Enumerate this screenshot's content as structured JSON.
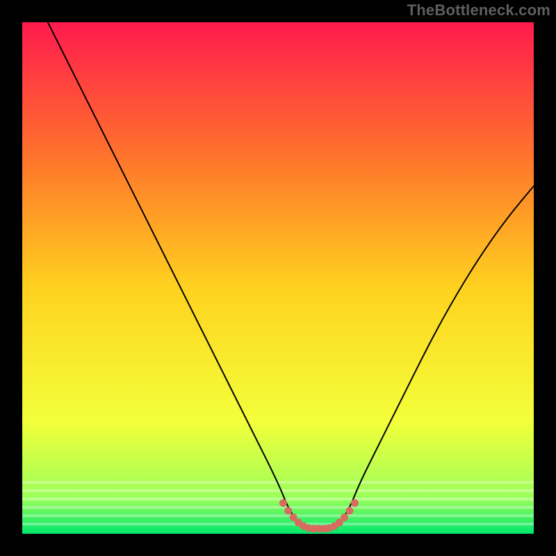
{
  "watermark": "TheBottleneck.com",
  "colors": {
    "bg": "#000000",
    "grad_top": "#ff1a4d",
    "grad_mid_upper": "#ff7a2a",
    "grad_mid": "#ffd21f",
    "grad_mid_lower": "#f3ff3a",
    "grad_low": "#9cff5a",
    "grad_bottom": "#00e86b",
    "curve": "#000000",
    "dots": "#d96a60"
  },
  "chart_data": {
    "type": "line",
    "title": "",
    "xlabel": "",
    "ylabel": "",
    "xlim": [
      0,
      100
    ],
    "ylim": [
      0,
      100
    ],
    "series": [
      {
        "name": "bottleneck-curve",
        "x": [
          5,
          10,
          15,
          20,
          25,
          30,
          35,
          40,
          45,
          50,
          52,
          54,
          56,
          58,
          60,
          62,
          64,
          66,
          70,
          75,
          80,
          85,
          90,
          95,
          100
        ],
        "values": [
          100,
          90,
          80,
          70,
          60,
          50,
          40,
          30,
          20,
          10,
          5,
          2,
          1,
          1,
          1,
          2,
          5,
          10,
          18,
          28,
          38,
          47,
          55,
          62,
          68
        ]
      }
    ],
    "trough_marker": {
      "name": "optimum-range-dots",
      "x": [
        51,
        52,
        53,
        54,
        55,
        56,
        57,
        58,
        59,
        60,
        61,
        62,
        63,
        64,
        65
      ],
      "values": [
        6,
        4.5,
        3.2,
        2.2,
        1.5,
        1.1,
        1.0,
        1.0,
        1.0,
        1.1,
        1.5,
        2.2,
        3.2,
        4.5,
        6
      ]
    }
  }
}
